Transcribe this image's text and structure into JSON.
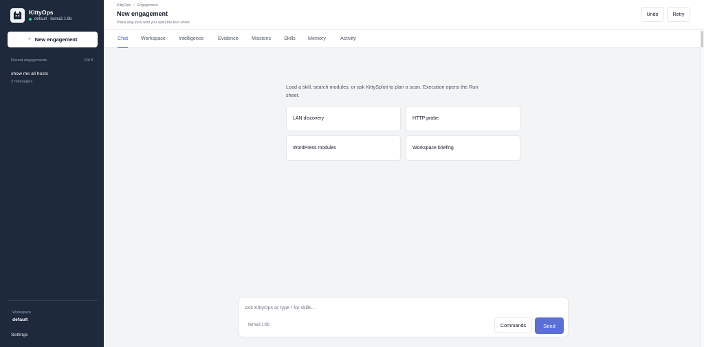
{
  "sidebar": {
    "brand_name": "KittyOps",
    "brand_sub": "default · llama3.1:8b",
    "logo_icon": "cat-logo-icon",
    "new_engagement_label": "New engagement",
    "new_engagement_prefix": "+",
    "recent_label": "Recent engagements",
    "recent_shortcut": "Ctrl K",
    "recent_items": [
      {
        "title": "show me all hosts",
        "meta": "2 messages"
      }
    ],
    "workspace_label": "Workspace",
    "workspace_value": "default",
    "settings_label": "Settings"
  },
  "header": {
    "breadcrumb": [
      "KittyOps",
      "Engagement"
    ],
    "breadcrumb_sep": "/",
    "title": "New engagement",
    "subtitle": "Plans stay local until you open the Run sheet.",
    "undo_label": "Undo",
    "retry_label": "Retry"
  },
  "tabs": [
    {
      "label": "Chat",
      "active": true
    },
    {
      "label": "Workspace",
      "active": false
    },
    {
      "label": "Intelligence",
      "active": false
    },
    {
      "label": "Evidence",
      "active": false
    },
    {
      "label": "Missions",
      "active": false
    },
    {
      "label": "Skills",
      "active": false
    },
    {
      "label": "Memory",
      "active": false
    },
    {
      "label": "Activity",
      "active": false
    }
  ],
  "main": {
    "intro": "Load a skill, search modules, or ask KittySploit to plan a scan. Execution opens the Run sheet.",
    "suggestions": [
      {
        "label": "LAN discovery"
      },
      {
        "label": "HTTP probe"
      },
      {
        "label": "WordPress modules"
      },
      {
        "label": "Workspace briefing"
      }
    ]
  },
  "composer": {
    "placeholder": "Ask KittyOps or type / for skills...",
    "value": "",
    "model": "llama3.1:8b",
    "commands_label": "Commands",
    "send_label": "Send"
  },
  "colors": {
    "sidebar_bg": "#1e293b",
    "accent": "#4f5bd5",
    "send_bg": "#5b6fd6",
    "status_online": "#34d399",
    "page_bg": "#f3f4f6"
  }
}
